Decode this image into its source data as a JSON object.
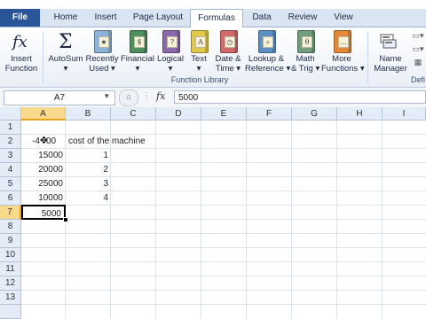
{
  "tabs": [
    "File",
    "Home",
    "Insert",
    "Page Layout",
    "Formulas",
    "Data",
    "Review",
    "View"
  ],
  "active_tab": "Formulas",
  "ribbon": {
    "insert_function": "Insert\nFunction",
    "autosum": "AutoSum",
    "recently_used": "Recently\nUsed",
    "financial": "Financial",
    "logical": "Logical",
    "text": "Text",
    "date_time": "Date &\nTime",
    "lookup_reference": "Lookup &\nReference",
    "math_trig": "Math\n& Trig",
    "more_functions": "More\nFunctions",
    "name_manager": "Name\nManager",
    "group_function_library": "Function Library",
    "group_defined_names_partial": "Defi"
  },
  "formula_bar": {
    "name_box": "A7",
    "fx": "fx",
    "value": "5000"
  },
  "columns": [
    "A",
    "B",
    "C",
    "D",
    "E",
    "F",
    "G",
    "H",
    "I"
  ],
  "rows": [
    "1",
    "2",
    "3",
    "4",
    "5",
    "6",
    "7",
    "8",
    "9",
    "10",
    "11",
    "12",
    "13"
  ],
  "cells": {
    "A2": "-4",
    "A2_tail": "00",
    "B2": "cost of the machine",
    "A3": "15000",
    "B3": "1",
    "A4": "20000",
    "B4": "2",
    "A5": "25000",
    "B5": "3",
    "A6": "10000",
    "B6": "4",
    "A7": "5000"
  },
  "selected_cell": "A7"
}
